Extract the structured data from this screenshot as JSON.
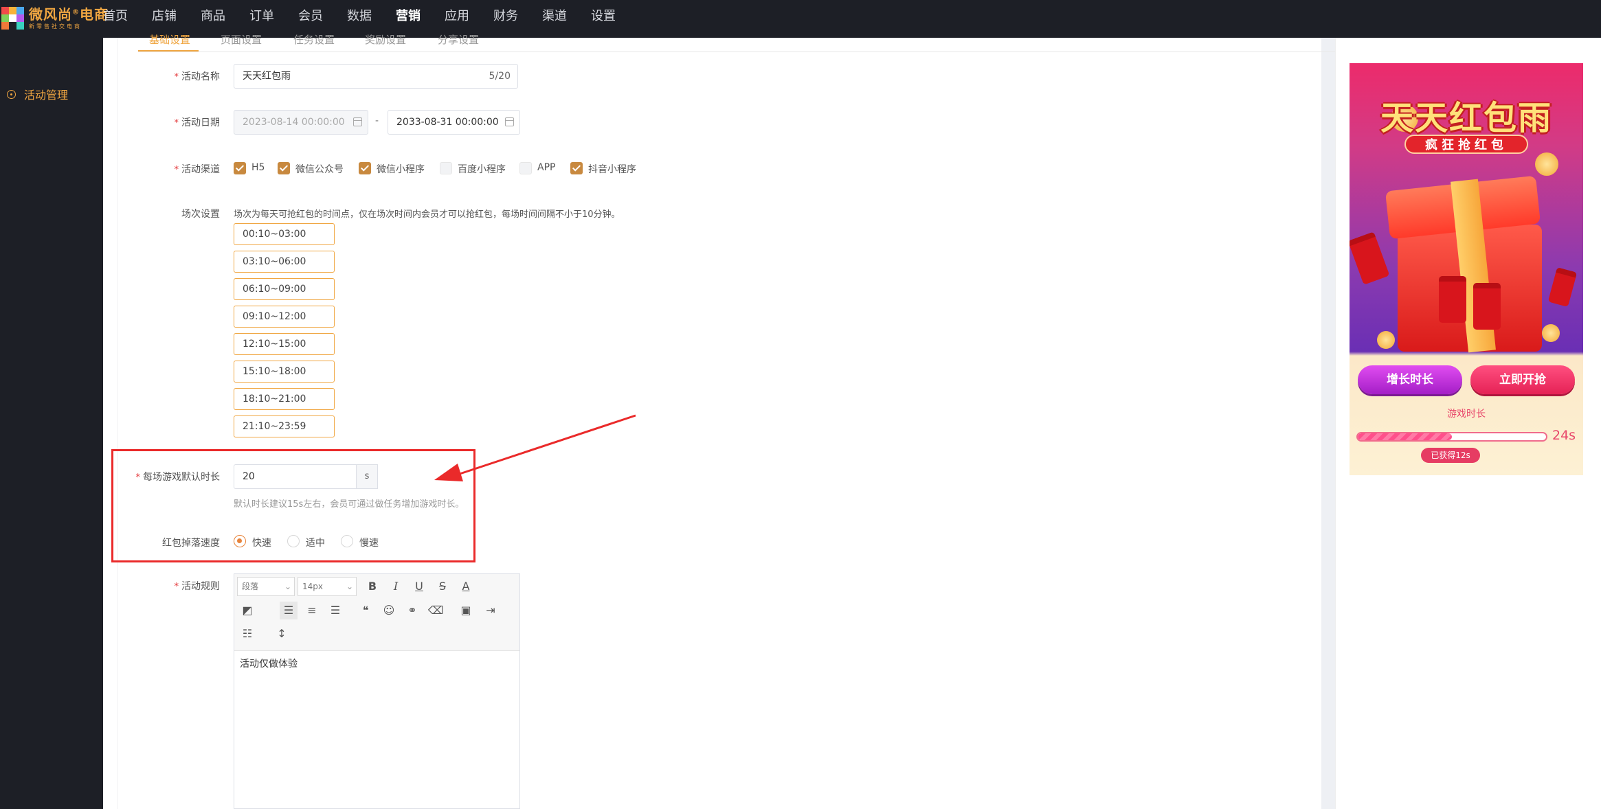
{
  "brand": {
    "name": "微风尚",
    "name_suffix": "电商",
    "slogan": "新零售社交电商"
  },
  "nav": {
    "items": [
      "首页",
      "店铺",
      "商品",
      "订单",
      "会员",
      "数据",
      "营销",
      "应用",
      "财务",
      "渠道",
      "设置"
    ],
    "active": "营销"
  },
  "sidebar": {
    "item": "活动管理"
  },
  "tabs": [
    "基础设置",
    "页面设置",
    "任务设置",
    "奖励设置",
    "分享设置"
  ],
  "form": {
    "name_label": "活动名称",
    "name_value": "天天红包雨",
    "name_counter": "5/20",
    "date_label": "活动日期",
    "date_start": "2023-08-14 00:00:00",
    "date_sep": "-",
    "date_end": "2033-08-31 00:00:00",
    "channel_label": "活动渠道",
    "channels": [
      {
        "label": "H5",
        "checked": true
      },
      {
        "label": "微信公众号",
        "checked": true
      },
      {
        "label": "微信小程序",
        "checked": true
      },
      {
        "label": "百度小程序",
        "checked": false
      },
      {
        "label": "APP",
        "checked": false
      },
      {
        "label": "抖音小程序",
        "checked": true
      }
    ],
    "session_label": "场次设置",
    "session_hint": "场次为每天可抢红包的时间点，仅在场次时间内会员才可以抢红包，每场时间间隔不小于10分钟。",
    "sessions": [
      "00:10~03:00",
      "03:10~06:00",
      "06:10~09:00",
      "09:10~12:00",
      "12:10~15:00",
      "15:10~18:00",
      "18:10~21:00",
      "21:10~23:59"
    ],
    "duration_label": "每场游戏默认时长",
    "duration_value": "20",
    "duration_unit": "s",
    "duration_hint": "默认时长建议15s左右，会员可通过做任务增加游戏时长。",
    "speed_label": "红包掉落速度",
    "speeds": [
      "快速",
      "适中",
      "慢速"
    ],
    "speed_selected": "快速",
    "rules_label": "活动规则",
    "required_mark": "*"
  },
  "editor": {
    "paragraph": "段落",
    "font_size": "14px",
    "content": "活动仅做体验",
    "tools": [
      "B",
      "I",
      "U",
      "S",
      "A"
    ]
  },
  "preview": {
    "title": "天天红包雨",
    "subtitle": "疯狂抢红包",
    "btn_extend": "增长时长",
    "btn_start": "立即开抢",
    "game_time_label": "游戏时长",
    "time_total": "24s",
    "earned": "已获得12s",
    "progress_fraction": 0.5
  },
  "colors": {
    "accent": "#f0a641",
    "checkbox": "#c8893f",
    "highlight_box": "#ea2a2a",
    "radio": "#e8833a"
  }
}
